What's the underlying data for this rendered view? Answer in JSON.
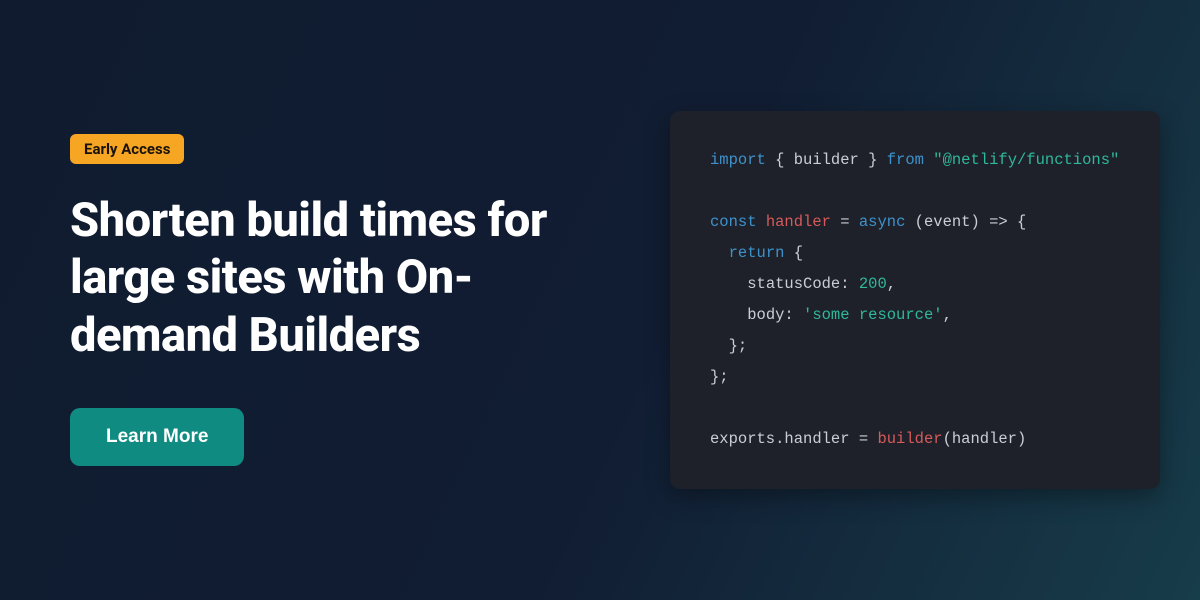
{
  "badge": {
    "label": "Early Access"
  },
  "headline": "Shorten build times for large sites with On-demand Builders",
  "cta": {
    "label": "Learn More"
  },
  "colors": {
    "badge_bg": "#f6a623",
    "cta_bg": "#0f8b81",
    "code_bg": "#1e2129",
    "page_grad_from": "#101b2f",
    "page_grad_to": "#173c4a"
  },
  "code": {
    "line1": {
      "import_kw": "import",
      "open_brace": " { ",
      "builder": "builder",
      "close_brace": " } ",
      "from_kw": "from",
      "space": " ",
      "module": "\"@netlify/functions\""
    },
    "line2_blank": "",
    "line3": {
      "const_kw": "const",
      "space1": " ",
      "handler_name": "handler",
      "eq": " = ",
      "async_kw": "async",
      "params": " (event) ",
      "arrow_open": "=> {"
    },
    "line4": {
      "indent": "  ",
      "return_kw": "return",
      "open": " {"
    },
    "line5": {
      "indent": "    ",
      "key": "statusCode: ",
      "val": "200",
      "comma": ","
    },
    "line6": {
      "indent": "    ",
      "key": "body: ",
      "val": "'some resource'",
      "comma": ","
    },
    "line7": {
      "indent": "  ",
      "close": "};"
    },
    "line8": {
      "close": "};"
    },
    "line9_blank": "",
    "line10": {
      "exports": "exports.handler = ",
      "builder_call": "builder",
      "args": "(handler)"
    }
  }
}
